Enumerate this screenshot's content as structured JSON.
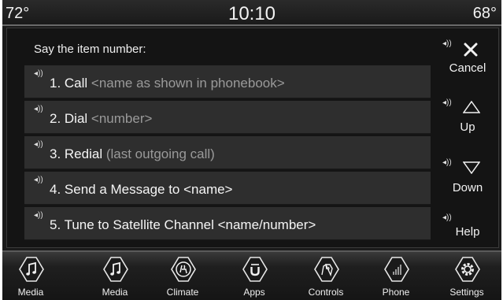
{
  "status": {
    "temp_left": "72°",
    "clock": "10:10",
    "temp_right": "68°"
  },
  "prompt": "Say the item number:",
  "items": [
    {
      "label": "1. Call",
      "hint": "<name as shown in phonebook>"
    },
    {
      "label": "2. Dial",
      "hint": "<number>"
    },
    {
      "label": "3. Redial",
      "hint": "(last outgoing call)"
    },
    {
      "label": "4. Send a Message to <name>",
      "hint": ""
    },
    {
      "label": "5. Tune to Satellite Channel <name/number>",
      "hint": ""
    }
  ],
  "side": {
    "cancel": "Cancel",
    "up": "Up",
    "down": "Down",
    "help": "Help"
  },
  "nav": [
    {
      "label": "Media",
      "icon": "music-note-icon"
    },
    {
      "label": "Media",
      "icon": "music-note-icon"
    },
    {
      "label": "Climate",
      "icon": "climate-seat-icon"
    },
    {
      "label": "Apps",
      "icon": "apps-icon"
    },
    {
      "label": "Controls",
      "icon": "controls-icon"
    },
    {
      "label": "Phone",
      "icon": "phone-signal-icon"
    },
    {
      "label": "Settings",
      "icon": "gear-icon"
    }
  ],
  "colors": {
    "background": "#1b1b1b",
    "row": "#2e2e2e",
    "hint_text": "#9a9a9a",
    "text": "#f5f5f5"
  }
}
